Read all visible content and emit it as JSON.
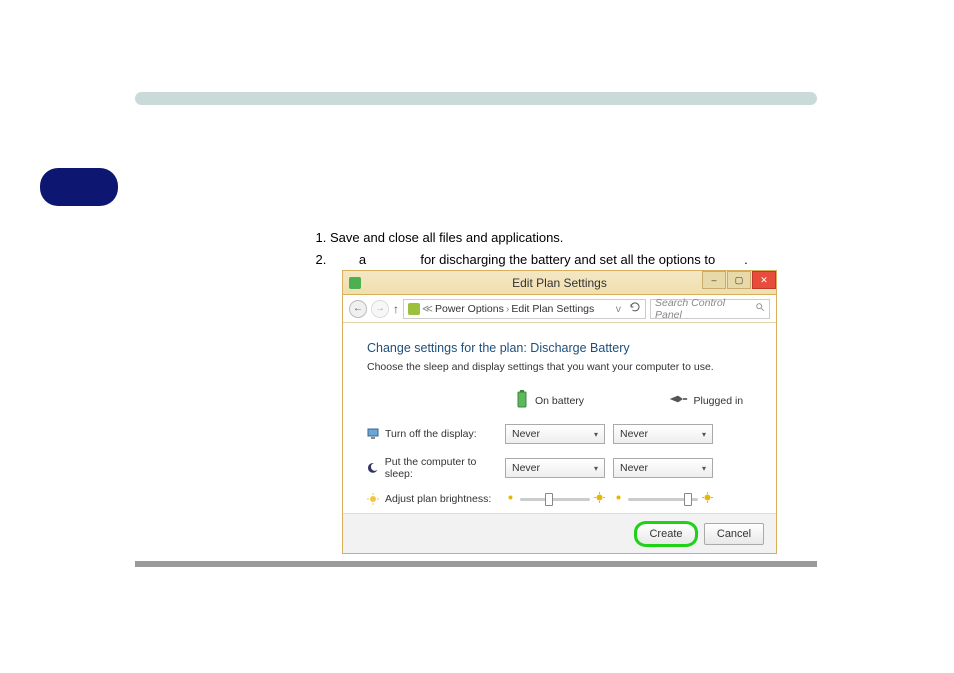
{
  "doc": {
    "step1": "Save and close all files and applications.",
    "step2_pre": "a",
    "step2_mid": "for discharging the battery and set all the options to",
    "step2_end": "."
  },
  "window": {
    "title": "Edit Plan Settings",
    "breadcrumb": {
      "part1": "Power Options",
      "part2": "Edit Plan Settings"
    },
    "search_placeholder": "Search Control Panel",
    "heading": "Change settings for the plan: Discharge Battery",
    "subtext": "Choose the sleep and display settings that you want your computer to use.",
    "columns": {
      "battery": "On battery",
      "plugged": "Plugged in"
    },
    "rows": {
      "display": {
        "label": "Turn off the display:",
        "on_battery": "Never",
        "plugged": "Never"
      },
      "sleep": {
        "label": "Put the computer to sleep:",
        "on_battery": "Never",
        "plugged": "Never"
      },
      "bright": {
        "label": "Adjust plan brightness:"
      }
    },
    "buttons": {
      "create": "Create",
      "cancel": "Cancel"
    },
    "slider_positions": {
      "bat": 35,
      "plug": 80
    }
  }
}
